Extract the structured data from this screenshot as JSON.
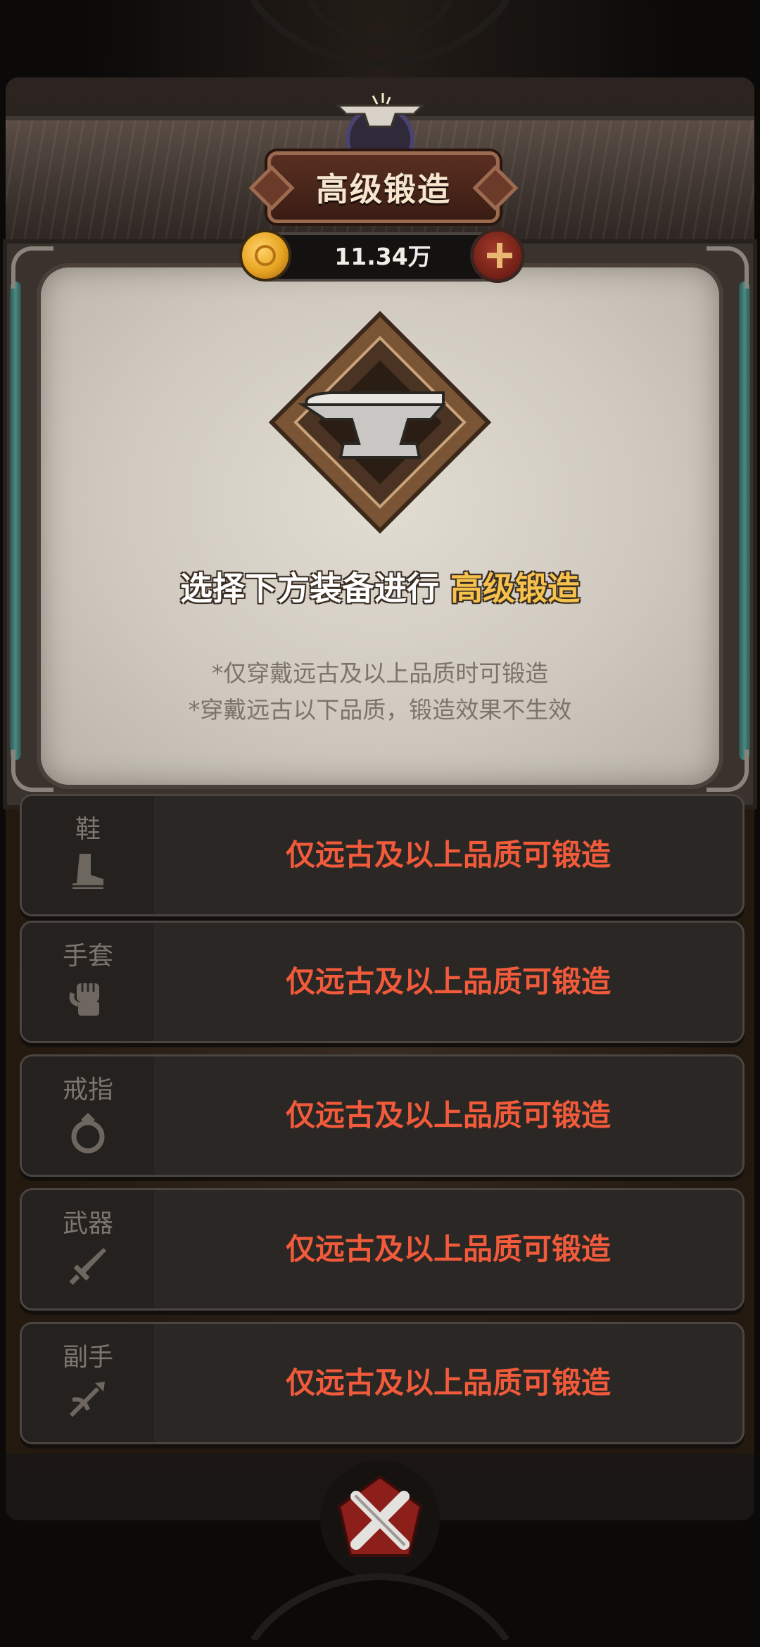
{
  "title": "高级锻造",
  "currency": {
    "amount": "11.34万",
    "icon": "gold-coin-icon",
    "add_icon": "plus-icon"
  },
  "emblem": {
    "icon": "anvil-icon"
  },
  "prompt": {
    "text": "选择下方装备进行",
    "highlight": "高级锻造"
  },
  "notes": [
    "*仅穿戴远古及以上品质时可锻造",
    "*穿戴远古以下品质，锻造效果不生效"
  ],
  "slots": [
    {
      "label": "鞋",
      "icon": "boot-icon",
      "message": "仅远古及以上品质可锻造"
    },
    {
      "label": "手套",
      "icon": "gauntlet-icon",
      "message": "仅远古及以上品质可锻造"
    },
    {
      "label": "戒指",
      "icon": "ring-icon",
      "message": "仅远古及以上品质可锻造"
    },
    {
      "label": "武器",
      "icon": "sword-icon",
      "message": "仅远古及以上品质可锻造"
    },
    {
      "label": "副手",
      "icon": "offhand-icon",
      "message": "仅远古及以上品质可锻造"
    }
  ],
  "close": {
    "icon": "close-icon"
  },
  "colors": {
    "highlight": "#f6c24c",
    "warning": "#f15a3a",
    "parchment": "#d9d3c9"
  }
}
